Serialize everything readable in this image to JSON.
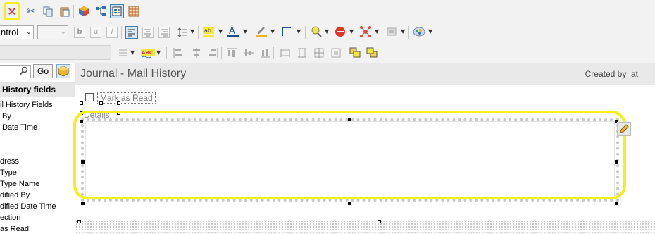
{
  "toolbar": {
    "row1_icons": [
      "delete-icon",
      "cut-icon",
      "copy-icon",
      "paste-icon",
      "cube-icon",
      "tree-icon",
      "form-view-icon",
      "table-view-icon"
    ],
    "font_name": "ntrol",
    "font_size": "",
    "bold_label": "b",
    "underline_label": "u",
    "italic_label": "i",
    "spelling_label": "ABC"
  },
  "search": {
    "value": "",
    "go_label": "Go"
  },
  "fields_panel": {
    "header": "History fields",
    "items": [
      "il History Fields",
      "By",
      "Date Time",
      "",
      "",
      "dress",
      "Type",
      "Type Name",
      "dified By",
      "dified Date Time",
      "ection",
      "as Read"
    ]
  },
  "form": {
    "title": "Journal - Mail History",
    "created_label": "Created by  at",
    "mark_as_read_label": "Mark as Read",
    "details_label": "Details:"
  },
  "colors": {
    "highlight": "#f2f21a",
    "toolbar_bg": "#f2f2f2",
    "title_bg": "#e9e9e9"
  }
}
